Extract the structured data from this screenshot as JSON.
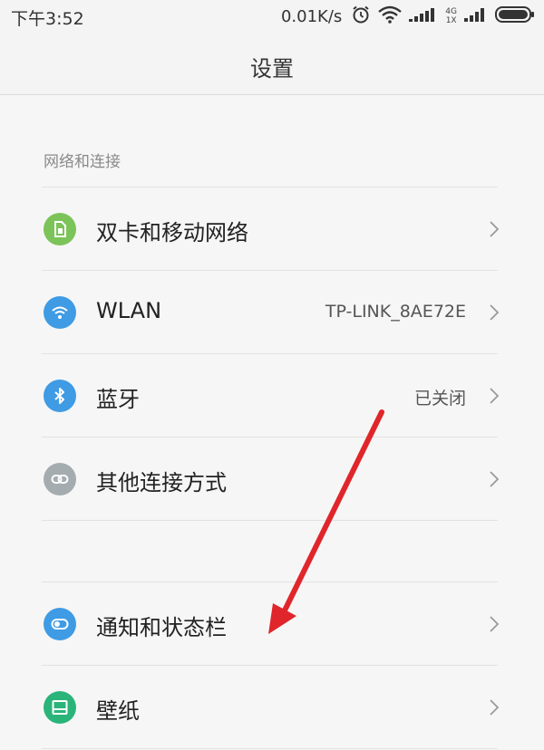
{
  "status_bar": {
    "time": "下午3:52",
    "net_speed": "0.01K/s",
    "sim1_label_top": "4G",
    "sim1_label_bottom": "1X",
    "icons": [
      "alarm-icon",
      "wifi-icon",
      "signal-bars-icon",
      "signal-bars-icon",
      "battery-icon"
    ]
  },
  "header": {
    "title": "设置"
  },
  "sections": {
    "network": {
      "title": "网络和连接",
      "items": [
        {
          "label": "双卡和移动网络",
          "value": "",
          "icon": "sim-card-icon",
          "icon_color": "#7cc35a"
        },
        {
          "label": "WLAN",
          "value": "TP-LINK_8AE72E",
          "icon": "wifi-icon",
          "icon_color": "#3f9be4"
        },
        {
          "label": "蓝牙",
          "value": "已关闭",
          "icon": "bluetooth-icon",
          "icon_color": "#3f9be4"
        },
        {
          "label": "其他连接方式",
          "value": "",
          "icon": "link-icon",
          "icon_color": "#a4acb0"
        }
      ]
    },
    "display": {
      "items": [
        {
          "label": "通知和状态栏",
          "value": "",
          "icon": "toggle-icon",
          "icon_color": "#3f9be4"
        },
        {
          "label": "壁纸",
          "value": "",
          "icon": "wallpaper-icon",
          "icon_color": "#2bb47a"
        }
      ]
    }
  },
  "annotation": {
    "arrow_color": "#e0262b"
  }
}
